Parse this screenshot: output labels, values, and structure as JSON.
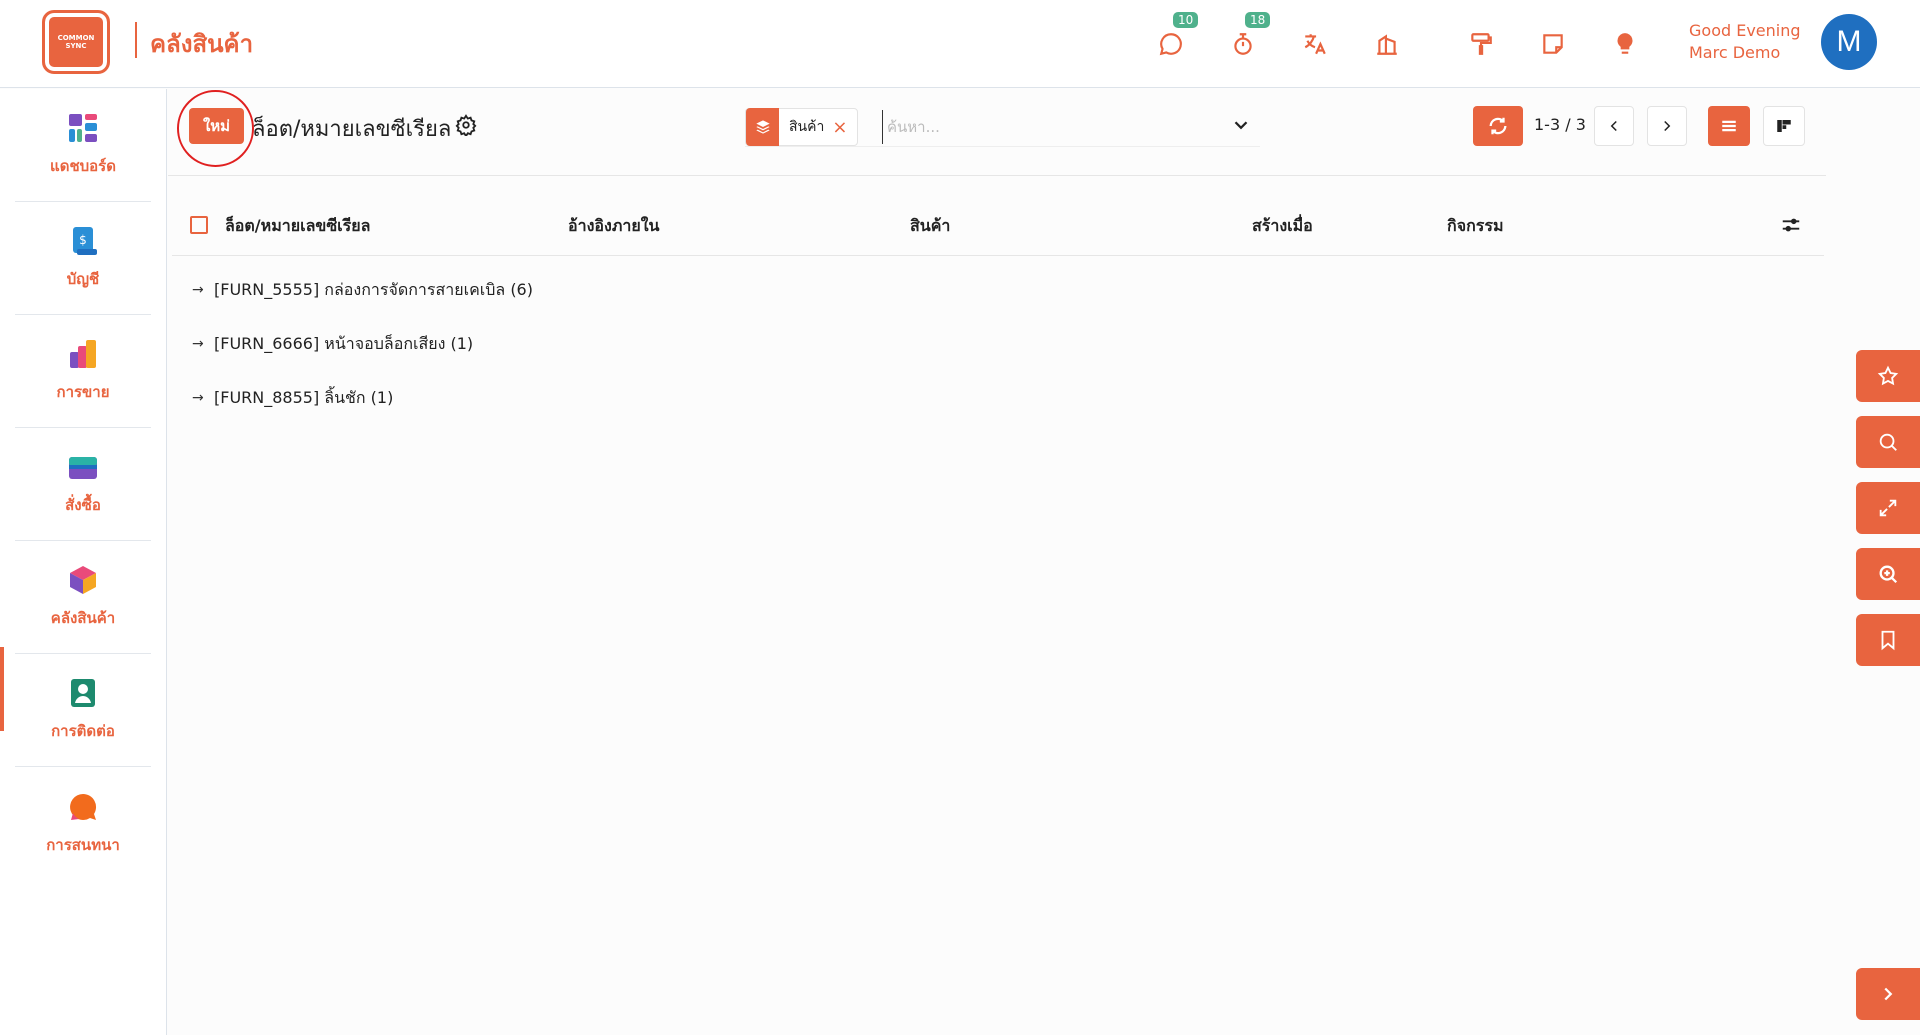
{
  "header": {
    "logo_text_line1": "COMMON",
    "logo_text_line2": "SYNC",
    "app_name": "คลังสินค้า",
    "messages_badge": "10",
    "activities_badge": "18",
    "greeting_line1": "Good Evening",
    "greeting_line2": "Marc Demo",
    "avatar_initial": "M"
  },
  "sidebar": {
    "items": [
      {
        "label": "แดชบอร์ด"
      },
      {
        "label": "บัญชี"
      },
      {
        "label": "การขาย"
      },
      {
        "label": "สั่งซื้อ"
      },
      {
        "label": "คลังสินค้า"
      },
      {
        "label": "การติดต่อ"
      },
      {
        "label": "การสนทนา"
      }
    ],
    "active": "คลังสินค้า"
  },
  "control": {
    "new_label": "ใหม่",
    "breadcrumb": "ล็อต/หมายเลขซีเรียล",
    "facet_value": "สินค้า",
    "facet_remove": "×",
    "search_placeholder": "ค้นหา...",
    "pager": "1-3 / 3"
  },
  "table": {
    "columns": [
      "ล็อต/หมายเลขซีเรียล",
      "อ้างอิงภายใน",
      "สินค้า",
      "สร้างเมื่อ",
      "กิจกรรม"
    ],
    "groups": [
      {
        "label": "[FURN_5555] กล่องการจัดการสายเคเบิล (6)"
      },
      {
        "label": "[FURN_6666] หน้าจอบล็อกเสียง (1)"
      },
      {
        "label": "[FURN_8855] ลิ้นชัก (1)"
      }
    ]
  },
  "colors": {
    "accent": "#e8643f",
    "badge": "#4fb18c",
    "avatar": "#1f6fc0",
    "annotation": "#e02020"
  }
}
